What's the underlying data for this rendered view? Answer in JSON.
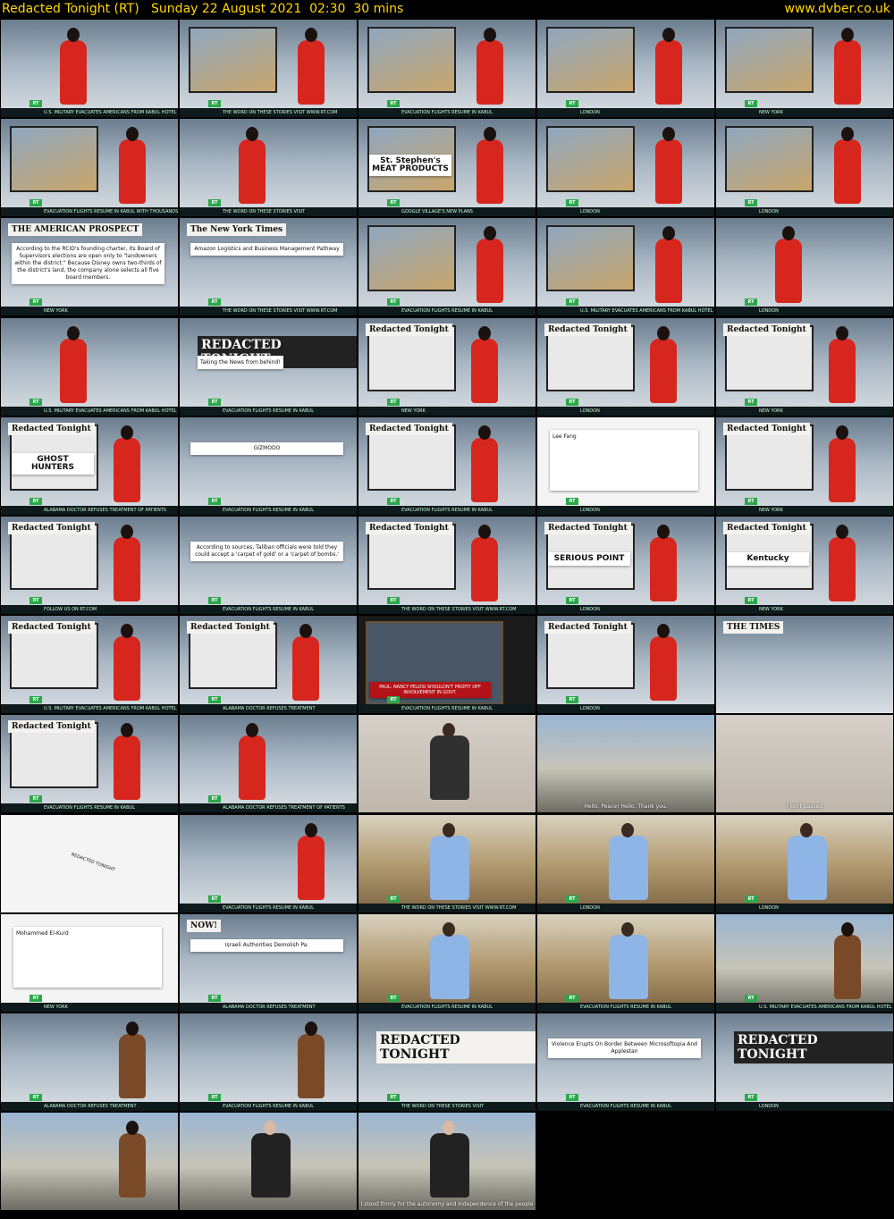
{
  "header": {
    "title": "Redacted Tonight (RT)   Sunday 22 August 2021  02:30  30 mins",
    "site": "www.dvber.co.uk"
  },
  "colors": {
    "header_text": "#ffd700",
    "rt_green": "#2aa84a",
    "presenter_red": "#d7261e"
  },
  "thumbs": [
    {
      "type": "presenter",
      "ticker": "U.S. MILITARY EVACUATES AMERICANS FROM KABUL HOTEL"
    },
    {
      "type": "presenter-screen",
      "ticker": "THE WORD ON THESE STORIES VISIT  WWW.RT.COM"
    },
    {
      "type": "presenter-screen",
      "ticker": "EVACUATION FLIGHTS RESUME IN KABUL"
    },
    {
      "type": "presenter-screen",
      "ticker": "LONDON"
    },
    {
      "type": "presenter-screen",
      "ticker": "NEW YORK"
    },
    {
      "type": "presenter-screen",
      "ticker": "EVACUATION FLIGHTS RESUME IN KABUL WITH THOUSANDS STRANDED"
    },
    {
      "type": "presenter",
      "ticker": "THE WORD ON THESE STORIES VISIT"
    },
    {
      "type": "presenter-screen",
      "ticker": "GOOGLE VILLAGE'S NEW PLANS",
      "card": "St. Stephen's MEAT PRODUCTS"
    },
    {
      "type": "presenter-screen",
      "ticker": "LONDON"
    },
    {
      "type": "presenter-screen",
      "ticker": "LONDON"
    },
    {
      "type": "card",
      "card": "According to the RCID's founding charter, its Board of Supervisors elections are open only to \"landowners within the district.\" Because Disney owns two-thirds of the district's land, the company alone selects all five board members.",
      "paper": "THE AMERICAN PROSPECT",
      "ticker": "NEW YORK"
    },
    {
      "type": "card",
      "card": "Amazon Logistics and Business Management Pathway",
      "paper": "The New York Times",
      "ticker": "THE WORD ON THESE STORIES VISIT  WWW.RT.COM"
    },
    {
      "type": "presenter-screen",
      "ticker": "EVACUATION FLIGHTS RESUME IN KABUL"
    },
    {
      "type": "presenter-screen",
      "ticker": "U.S. MILITARY EVACUATES AMERICANS FROM KABUL HOTEL"
    },
    {
      "type": "presenter",
      "ticker": "LONDON"
    },
    {
      "type": "presenter",
      "ticker": "U.S. MILITARY EVACUATES AMERICANS FROM KABUL HOTEL"
    },
    {
      "type": "logo",
      "paper": "REDACTED TONIGHT",
      "card": "Taking the News from behind!",
      "ticker": "EVACUATION FLIGHTS RESUME IN KABUL"
    },
    {
      "type": "desk",
      "paper": "Redacted Tonight",
      "ticker": "NEW YORK"
    },
    {
      "type": "desk",
      "paper": "Redacted Tonight",
      "ticker": "LONDON"
    },
    {
      "type": "desk",
      "paper": "Redacted Tonight",
      "ticker": "NEW YORK"
    },
    {
      "type": "desk",
      "paper": "Redacted Tonight",
      "card": "GHOST HUNTERS",
      "ticker": "ALABAMA DOCTOR REFUSES TREATMENT OF PATIENTS"
    },
    {
      "type": "card",
      "card": "GIZMODO",
      "ticker": "EVACUATION FLIGHTS RESUME IN KABUL"
    },
    {
      "type": "desk",
      "paper": "Redacted Tonight",
      "ticker": "EVACUATION FLIGHTS RESUME IN KABUL"
    },
    {
      "type": "tweet",
      "card": "Lee Fang",
      "ticker": "LONDON"
    },
    {
      "type": "desk",
      "paper": "Redacted Tonight",
      "ticker": "NEW YORK"
    },
    {
      "type": "desk",
      "paper": "Redacted Tonight",
      "ticker": "FOLLOW US ON  RT.COM"
    },
    {
      "type": "card",
      "card": "According to sources, Taliban officials were told they could accept a 'carpet of gold' or a 'carpet of bombs.'",
      "ticker": "EVACUATION FLIGHTS RESUME IN KABUL"
    },
    {
      "type": "desk",
      "paper": "Redacted Tonight",
      "ticker": "THE WORD ON THESE STORIES VISIT  WWW.RT.COM"
    },
    {
      "type": "desk",
      "paper": "Redacted Tonight",
      "card": "SERIOUS POINT",
      "ticker": "LONDON"
    },
    {
      "type": "desk",
      "paper": "Redacted Tonight",
      "card": "Kentucky",
      "ticker": "NEW YORK"
    },
    {
      "type": "desk",
      "paper": "Redacted Tonight",
      "ticker": "U.S. MILITARY EVACUATES AMERICANS FROM KABUL HOTEL"
    },
    {
      "type": "desk",
      "paper": "Redacted Tonight",
      "ticker": "ALABAMA DOCTOR REFUSES TREATMENT"
    },
    {
      "type": "tv",
      "card": "PAUL: NANCY PELOSI SHOULDN'T PROFIT OFF INVOLVEMENT IN GOVT.",
      "ticker": "EVACUATION FLIGHTS RESUME IN KABUL"
    },
    {
      "type": "desk",
      "paper": "Redacted Tonight",
      "ticker": "LONDON"
    },
    {
      "type": "paper",
      "paper": "THE TIMES",
      "ticker": ""
    },
    {
      "type": "desk",
      "paper": "Redacted Tonight",
      "ticker": "EVACUATION FLIGHTS RESUME IN KABUL"
    },
    {
      "type": "presenter",
      "ticker": "ALABAMA DOCTOR REFUSES TREATMENT OF PATIENTS"
    },
    {
      "type": "interview",
      "ticker": ""
    },
    {
      "type": "street",
      "sub": "Hello. Peace! Hello. Thank you.",
      "ticker": ""
    },
    {
      "type": "hall",
      "sub": "Flight passed",
      "ticker": ""
    },
    {
      "type": "white",
      "card": "REDACTED TONIGHT",
      "ticker": ""
    },
    {
      "type": "split",
      "ticker": "EVACUATION FLIGHTS RESUME IN KABUL"
    },
    {
      "type": "alley",
      "ticker": "THE WORD ON THESE STORIES VISIT  WWW.RT.COM"
    },
    {
      "type": "alley",
      "ticker": "LONDON"
    },
    {
      "type": "alley",
      "ticker": "LONDON"
    },
    {
      "type": "tweet",
      "card": "Mohammed El-Kurd",
      "ticker": "NEW YORK"
    },
    {
      "type": "card",
      "card": "Israeli Authorities Demolish Pa.",
      "paper": "NOW!",
      "ticker": "ALABAMA DOCTOR REFUSES TREATMENT"
    },
    {
      "type": "alley",
      "ticker": "EVACUATION FLIGHTS RESUME IN KABUL"
    },
    {
      "type": "alley",
      "ticker": "EVACUATION FLIGHTS RESUME IN KABUL"
    },
    {
      "type": "outdoor",
      "ticker": "U.S. MILITARY EVACUATES AMERICANS FROM KABUL HOTEL"
    },
    {
      "type": "guest",
      "ticker": "ALABAMA DOCTOR REFUSES TREATMENT"
    },
    {
      "type": "guest",
      "ticker": "EVACUATION FLIGHTS RESUME IN KABUL"
    },
    {
      "type": "studio",
      "paper": "REDACTED TONIGHT",
      "ticker": "THE WORD ON THESE STORIES VISIT"
    },
    {
      "type": "card",
      "card": "Violence Erupts On Border Between Microsoftopia And Applestan",
      "ticker": "EVACUATION FLIGHTS RESUME IN KABUL"
    },
    {
      "type": "logo",
      "paper": "REDACTED TONIGHT",
      "ticker": "LONDON"
    },
    {
      "type": "outdoor",
      "ticker": ""
    },
    {
      "type": "archive",
      "ticker": ""
    },
    {
      "type": "archive",
      "sub": "I stood firmly for the autonomy and independence of the people",
      "ticker": ""
    }
  ]
}
